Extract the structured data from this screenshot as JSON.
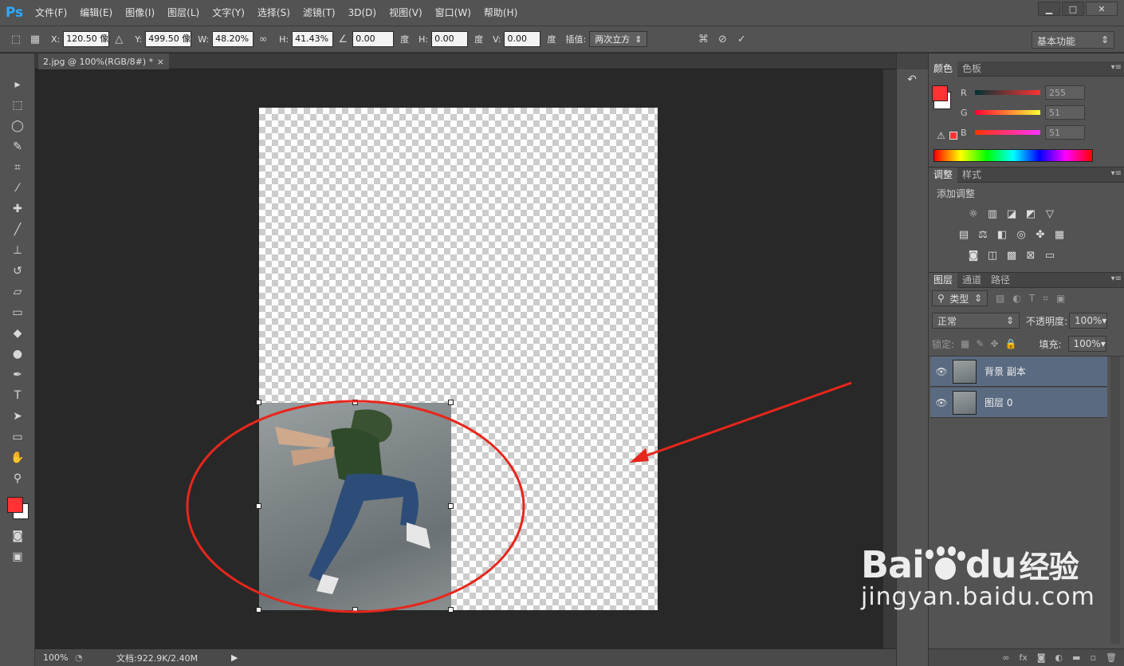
{
  "app": {
    "logo": "Ps"
  },
  "menu": [
    "文件(F)",
    "编辑(E)",
    "图像(I)",
    "图层(L)",
    "文字(Y)",
    "选择(S)",
    "滤镜(T)",
    "3D(D)",
    "视图(V)",
    "窗口(W)",
    "帮助(H)"
  ],
  "window_buttons": {
    "minimize": "▁",
    "maximize": "□",
    "close": "✕"
  },
  "options": {
    "x_label": "X:",
    "x_value": "120.50 像",
    "y_label": "Y:",
    "y_value": "499.50 像",
    "w_label": "W:",
    "w_value": "48.20%",
    "h_label": "H:",
    "h_value": "41.43%",
    "angle_value": "0.00",
    "angle_unit": "度",
    "hskew_label": "H:",
    "hskew_value": "0.00",
    "hskew_unit": "度",
    "vskew_label": "V:",
    "vskew_value": "0.00",
    "vskew_unit": "度",
    "interp_label": "插值:",
    "interp_value": "两次立方",
    "workspace": "基本功能"
  },
  "document": {
    "tab_title": "2.jpg @ 100%(RGB/8#) *",
    "tab_close": "×",
    "zoom": "100%",
    "doc_info": "文档:922.9K/2.40M"
  },
  "color_panel": {
    "tabs": [
      "颜色",
      "色板"
    ],
    "r_label": "R",
    "r_value": "255",
    "g_label": "G",
    "g_value": "51",
    "b_label": "B",
    "b_value": "51",
    "foreground": "#ff3333"
  },
  "adjust_panel": {
    "tabs": [
      "调整",
      "样式"
    ],
    "title": "添加调整"
  },
  "layers_panel": {
    "tabs": [
      "图层",
      "通道",
      "路径"
    ],
    "filter_kind": "类型",
    "blend_mode": "正常",
    "opacity_label": "不透明度:",
    "opacity_value": "100%",
    "lock_label": "锁定:",
    "fill_label": "填充:",
    "fill_value": "100%",
    "layers": [
      {
        "name": "背景 副本"
      },
      {
        "name": "图层 0"
      }
    ]
  },
  "watermark": {
    "brand": "Bai",
    "brand2": "du",
    "cn": "经验",
    "url": "jingyan.baidu.com"
  },
  "colors": {
    "annotation": "#e8261c",
    "selected_layer": "#5a6a80"
  }
}
